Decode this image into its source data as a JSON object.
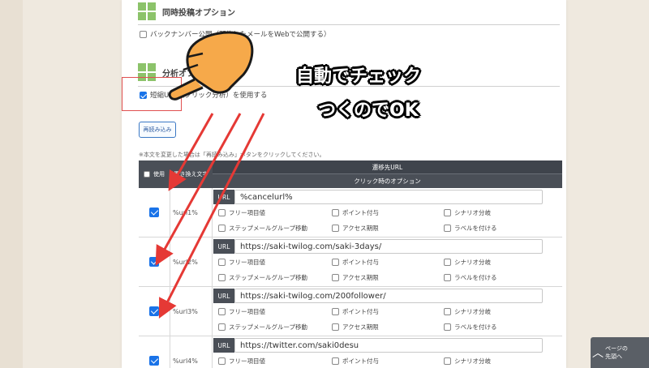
{
  "sections": {
    "concurrent": {
      "title": "同時投稿オプション",
      "option_label": "バックナンバー公開（配信したメールをWebで公開する）"
    },
    "analysis": {
      "title": "分析オプション",
      "option_label": "短縮URL（クリック分析）を使用する",
      "checked": true
    }
  },
  "reload_button": "再読み込み",
  "note": "※本文を変更した場合は「再読み込み」ボタンをクリックしてください。",
  "table": {
    "header_use": "使用",
    "header_replace": "置き換え文字",
    "header_dest": "遷移先URL",
    "header_click_options": "クリック時のオプション",
    "url_tag": "URL",
    "options": [
      "フリー項目値",
      "ポイント付与",
      "シナリオ分岐",
      "ステップメールグループ移動",
      "アクセス期限",
      "ラベルを付ける"
    ],
    "rows": [
      {
        "var": "%url1%",
        "url": "%cancelurl%",
        "checked": true
      },
      {
        "var": "%url2%",
        "url": "https://saki-twilog.com/saki-3days/",
        "checked": true
      },
      {
        "var": "%url3%",
        "url": "https://saki-twilog.com/200follower/",
        "checked": true
      },
      {
        "var": "%url4%",
        "url": "https://twitter.com/saki0desu",
        "checked": true
      }
    ]
  },
  "overlay": {
    "line1": "自動でチェック",
    "line2": "つくのでOK"
  },
  "page_nav": {
    "line1": "ページの",
    "line2": "先頭へ"
  },
  "colors": {
    "accent_green": "#8cc36a",
    "header_dark": "#4a4f57",
    "check_blue": "#1a73e8",
    "annotation_red": "#e53935",
    "hand_orange": "#f6a94a"
  }
}
